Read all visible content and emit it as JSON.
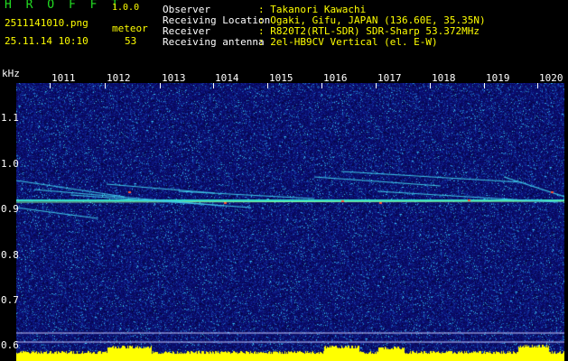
{
  "header": {
    "app_title": "H R O F F T",
    "app_version": "1.0.0",
    "file_name": "2511141010.png",
    "meteor_label": "meteor",
    "timestamp": "25.11.14 10:10",
    "meteor_count": "53"
  },
  "info": [
    {
      "key": "Observer",
      "value": ": Takanori Kawachi"
    },
    {
      "key": "Receiving Location",
      "value": ": Ogaki, Gifu, JAPAN (136.60E, 35.35N)"
    },
    {
      "key": "Receiver",
      "value": ": R820T2(RTL-SDR) SDR-Sharp 53.372MHz"
    },
    {
      "key": "Receiving antenna",
      "value": ": 2el-HB9CV Vertical (el. E-W)"
    }
  ],
  "axis": {
    "unit": "kHz",
    "x_ticks": [
      "1011",
      "1012",
      "1013",
      "1014",
      "1015",
      "1016",
      "1017",
      "1018",
      "1019",
      "1020"
    ],
    "y_ticks": [
      "1.1",
      "1.0",
      "0.9",
      "0.8",
      "0.7",
      "0.6"
    ]
  },
  "colors": {
    "background_noise": "#0a0d6e",
    "signal": "#22ccff",
    "baseline_bars": "#ffff00",
    "text_label": "#ffffff",
    "text_value": "#ffff00",
    "title": "#22dd22"
  }
}
